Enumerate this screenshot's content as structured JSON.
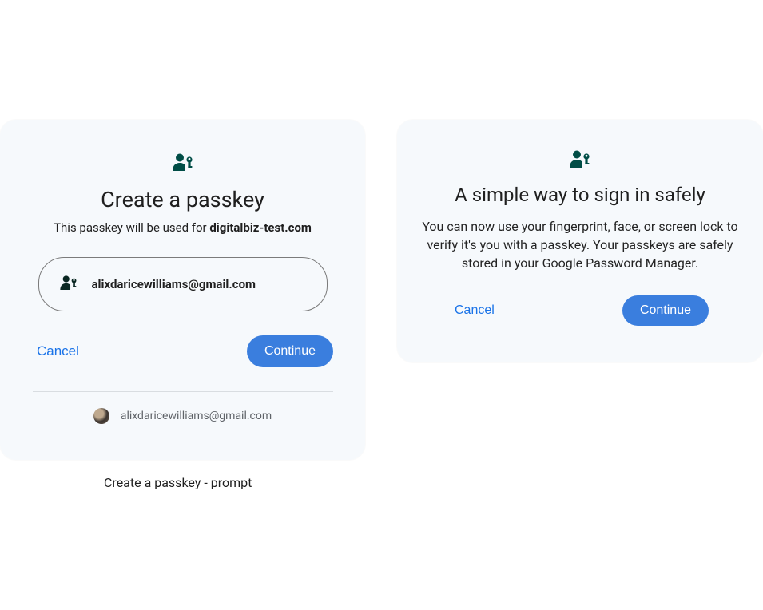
{
  "left": {
    "title": "Create a passkey",
    "subtitle_prefix": "This passkey will be used for ",
    "subtitle_domain": "digitalbiz-test.com",
    "account_email": "alixdaricewilliams@gmail.com",
    "cancel_label": "Cancel",
    "continue_label": "Continue",
    "footer_email": "alixdaricewilliams@gmail.com",
    "caption": "Create a passkey - prompt"
  },
  "right": {
    "title": "A simple way to sign in safely",
    "body": "You can now use your fingerprint, face, or screen lock to verify it's you with a passkey. Your passkeys are safely stored in your Google Password Manager.",
    "cancel_label": "Cancel",
    "continue_label": "Continue"
  },
  "colors": {
    "icon_teal": "#004d46",
    "icon_dark": "#0a2722",
    "primary_blue": "#3a7ede",
    "link_blue": "#1a73e8",
    "card_bg": "#f6f9fc"
  }
}
